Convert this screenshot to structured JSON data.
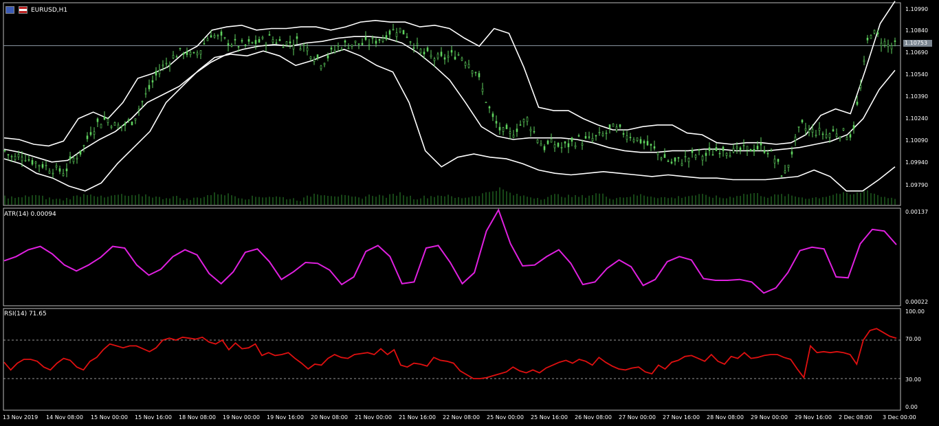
{
  "main": {
    "symbol_label": "EURUSD,H1",
    "price_ticks": [
      "1.10990",
      "1.10840",
      "1.10690",
      "1.10540",
      "1.10390",
      "1.10240",
      "1.10090",
      "1.09940",
      "1.09790"
    ],
    "current_price": "1.10753",
    "ylim": [
      1.0976,
      1.1102
    ],
    "current_price_value": 1.10753
  },
  "atr": {
    "label": "ATR(14) 0.00094",
    "ticks": [
      "0.00137",
      "0.00022"
    ],
    "ylim": [
      0.00022,
      0.00137
    ]
  },
  "rsi": {
    "label": "RSI(14) 71.65",
    "ticks": [
      "100.00",
      "70.00",
      "30.00",
      "0.00"
    ],
    "levels": [
      70,
      30
    ],
    "ylim": [
      0,
      100
    ]
  },
  "time_axis": [
    "13 Nov 2019",
    "14 Nov 08:00",
    "15 Nov 00:00",
    "15 Nov 16:00",
    "18 Nov 08:00",
    "19 Nov 00:00",
    "19 Nov 16:00",
    "20 Nov 08:00",
    "21 Nov 00:00",
    "21 Nov 16:00",
    "22 Nov 08:00",
    "25 Nov 00:00",
    "25 Nov 16:00",
    "26 Nov 08:00",
    "27 Nov 00:00",
    "27 Nov 16:00",
    "28 Nov 08:00",
    "29 Nov 00:00",
    "29 Nov 16:00",
    "2 Dec 08:00",
    "3 Dec 00:00"
  ],
  "colors": {
    "background": "#000000",
    "candle": "#5fd35f",
    "volume": "#2e8b2e",
    "bands": "#ffffff",
    "atr": "#e020e0",
    "rsi": "#e01010",
    "grid": "#555555"
  },
  "chart_data": [
    {
      "type": "line",
      "title": "EURUSD,H1",
      "xlabel": "",
      "ylabel": "",
      "x_index": [
        0,
        10,
        20,
        30,
        40,
        50,
        60,
        70,
        80,
        90,
        100,
        110,
        120,
        130,
        140,
        150,
        160,
        170,
        180,
        190,
        200
      ],
      "x_labels": [
        "13 Nov 2019",
        "14 Nov 08:00",
        "15 Nov 00:00",
        "15 Nov 16:00",
        "18 Nov 08:00",
        "19 Nov 00:00",
        "19 Nov 16:00",
        "20 Nov 08:00",
        "21 Nov 00:00",
        "21 Nov 16:00",
        "22 Nov 08:00",
        "25 Nov 00:00",
        "25 Nov 16:00",
        "26 Nov 08:00",
        "27 Nov 00:00",
        "27 Nov 16:00",
        "28 Nov 08:00",
        "29 Nov 00:00",
        "29 Nov 16:00",
        "2 Dec 08:00",
        "3 Dec 00:00"
      ],
      "ylim": [
        1.0976,
        1.1102
      ],
      "series": [
        {
          "name": "Close",
          "values": [
            1.101,
            1.1005,
            1.1008,
            1.1004,
            1.1002,
            1.1,
            1.0998,
            1.0997,
            1.1005,
            1.101,
            1.1022,
            1.1028,
            1.103,
            1.1025,
            1.1026,
            1.1029,
            1.104,
            1.105,
            1.106,
            1.1065,
            1.107,
            1.1072,
            1.1068,
            1.1074,
            1.1083,
            1.108,
            1.1078,
            1.1076,
            1.1075,
            1.1077,
            1.1078,
            1.108,
            1.1078,
            1.1077,
            1.1078,
            1.1075,
            1.107,
            1.1065,
            1.107,
            1.1075,
            1.1076,
            1.1077,
            1.1076,
            1.1078,
            1.108,
            1.1084,
            1.1086,
            1.1082,
            1.1075,
            1.107,
            1.1068,
            1.1067,
            1.1069,
            1.107,
            1.1066,
            1.106,
            1.1045,
            1.103,
            1.1022,
            1.102,
            1.1025,
            1.103,
            1.102,
            1.1012,
            1.1015,
            1.1012,
            1.1014,
            1.1017,
            1.1016,
            1.1018,
            1.102,
            1.1024,
            1.1022,
            1.102,
            1.1017,
            1.1014,
            1.101,
            1.1006,
            1.1002,
            1.1004,
            1.1006,
            1.1008,
            1.1007,
            1.101,
            1.1012,
            1.1009,
            1.101,
            1.1011,
            1.1012,
            1.1011,
            1.1005,
            1.0993,
            1.101,
            1.1026,
            1.1022,
            1.1022,
            1.102,
            1.1022,
            1.1021,
            1.102,
            1.105,
            1.1085,
            1.1081,
            1.1076,
            1.1075
          ]
        },
        {
          "name": "Upper band",
          "values": [
            1.1018,
            1.1017,
            1.1014,
            1.1013,
            1.1016,
            1.103,
            1.1034,
            1.103,
            1.104,
            1.1055,
            1.1058,
            1.1062,
            1.107,
            1.1075,
            1.1085,
            1.1087,
            1.1088,
            1.1085,
            1.1086,
            1.1086,
            1.1087,
            1.1087,
            1.1085,
            1.1087,
            1.109,
            1.1091,
            1.109,
            1.109,
            1.1087,
            1.1088,
            1.1086,
            1.108,
            1.1075,
            1.1086,
            1.1083,
            1.1062,
            1.1037,
            1.1035,
            1.1035,
            1.103,
            1.1026,
            1.1023,
            1.1023,
            1.1025,
            1.1026,
            1.1026,
            1.1021,
            1.102,
            1.1015,
            1.1014,
            1.1015,
            1.1015,
            1.1014,
            1.1015,
            1.102,
            1.1032,
            1.1036,
            1.1033,
            1.106,
            1.1089,
            1.1103
          ]
        },
        {
          "name": "Middle band",
          "values": [
            1.1011,
            1.1009,
            1.1006,
            1.1003,
            1.1004,
            1.1011,
            1.1017,
            1.1022,
            1.103,
            1.104,
            1.1045,
            1.105,
            1.1058,
            1.1065,
            1.107,
            1.1073,
            1.1075,
            1.1076,
            1.1075,
            1.1077,
            1.1078,
            1.108,
            1.1081,
            1.1081,
            1.108,
            1.1077,
            1.1071,
            1.1063,
            1.1054,
            1.104,
            1.1025,
            1.1019,
            1.1017,
            1.1018,
            1.1018,
            1.1018,
            1.1017,
            1.1015,
            1.1012,
            1.101,
            1.1009,
            1.1009,
            1.101,
            1.101,
            1.1011,
            1.1011,
            1.101,
            1.101,
            1.101,
            1.1011,
            1.1012,
            1.1014,
            1.1016,
            1.102,
            1.103,
            1.1048,
            1.106
          ]
        },
        {
          "name": "Lower band",
          "values": [
            1.1005,
            1.1002,
            1.0996,
            1.0993,
            1.0988,
            1.0985,
            1.099,
            1.1002,
            1.1012,
            1.1022,
            1.104,
            1.105,
            1.106,
            1.1068,
            1.107,
            1.1069,
            1.1072,
            1.1069,
            1.1063,
            1.1066,
            1.107,
            1.1073,
            1.1069,
            1.1063,
            1.1059,
            1.104,
            1.101,
            1.1,
            1.1006,
            1.1008,
            1.1006,
            1.1005,
            1.1002,
            1.0998,
            1.0996,
            1.0995,
            1.0996,
            1.0997,
            1.0996,
            1.0995,
            1.0994,
            1.0995,
            1.0994,
            1.0993,
            1.0993,
            1.0992,
            1.0992,
            1.0992,
            1.0993,
            1.0994,
            1.0998,
            1.0994,
            1.0985,
            1.0985,
            1.0992,
            1.1
          ]
        }
      ],
      "volume_series": [
        4,
        3,
        5,
        3,
        2,
        4,
        6,
        3,
        5,
        4,
        5,
        3,
        4,
        2,
        4,
        6,
        5,
        3,
        4,
        4,
        3,
        2,
        6,
        5,
        4,
        3,
        5,
        4,
        6,
        3,
        4,
        5,
        3,
        4,
        6,
        9,
        5,
        4,
        3,
        5,
        4,
        4,
        6,
        3,
        4,
        5,
        4,
        3,
        4,
        5,
        4,
        3,
        5,
        6,
        4,
        5,
        4,
        3,
        4,
        6,
        5,
        8,
        4,
        3
      ]
    },
    {
      "type": "line",
      "title": "ATR(14) 0.00094",
      "ylim": [
        0.00022,
        0.00137
      ],
      "series": [
        {
          "name": "ATR(14)",
          "values": [
            0.00075,
            0.0008,
            0.00088,
            0.00092,
            0.00083,
            0.0007,
            0.00063,
            0.0007,
            0.00079,
            0.00092,
            0.0009,
            0.0007,
            0.00058,
            0.00065,
            0.0008,
            0.00088,
            0.00082,
            0.0006,
            0.00048,
            0.00062,
            0.00085,
            0.00089,
            0.00074,
            0.00053,
            0.00062,
            0.00073,
            0.00072,
            0.00064,
            0.00047,
            0.00056,
            0.00086,
            0.00093,
            0.0008,
            0.00048,
            0.0005,
            0.0009,
            0.00093,
            0.00073,
            0.00048,
            0.00061,
            0.0011,
            0.00135,
            0.00095,
            0.00069,
            0.0007,
            0.0008,
            0.00088,
            0.00072,
            0.00047,
            0.0005,
            0.00066,
            0.00076,
            0.00068,
            0.00046,
            0.00053,
            0.00074,
            0.0008,
            0.00076,
            0.00054,
            0.00052,
            0.00052,
            0.00053,
            0.0005,
            0.00037,
            0.00043,
            0.00061,
            0.00087,
            0.00091,
            0.00089,
            0.00056,
            0.00055,
            0.00095,
            0.00112,
            0.0011,
            0.00094
          ]
        }
      ]
    },
    {
      "type": "line",
      "title": "RSI(14) 71.65",
      "ylim": [
        0,
        100
      ],
      "series": [
        {
          "name": "RSI(14)",
          "values": [
            47,
            39,
            46,
            50,
            50,
            48,
            42,
            39,
            46,
            51,
            49,
            42,
            39,
            48,
            52,
            60,
            66,
            64,
            62,
            64,
            64,
            61,
            58,
            62,
            70,
            72,
            70,
            73,
            72,
            71,
            73,
            68,
            66,
            70,
            60,
            67,
            61,
            62,
            66,
            54,
            57,
            54,
            55,
            57,
            51,
            46,
            40,
            45,
            44,
            51,
            55,
            52,
            51,
            55,
            56,
            57,
            55,
            61,
            55,
            60,
            44,
            42,
            46,
            45,
            43,
            52,
            49,
            48,
            46,
            38,
            34,
            30,
            30,
            31,
            33,
            35,
            37,
            42,
            38,
            36,
            39,
            36,
            41,
            44,
            47,
            49,
            46,
            50,
            48,
            44,
            52,
            47,
            43,
            40,
            39,
            41,
            42,
            37,
            35,
            44,
            40,
            47,
            49,
            53,
            54,
            51,
            48,
            55,
            48,
            45,
            53,
            51,
            57,
            51,
            52,
            54,
            55,
            55,
            52,
            50,
            40,
            31,
            64,
            57,
            58,
            57,
            58,
            57,
            55,
            45,
            70,
            80,
            82,
            78,
            74,
            72
          ]
        }
      ]
    }
  ]
}
